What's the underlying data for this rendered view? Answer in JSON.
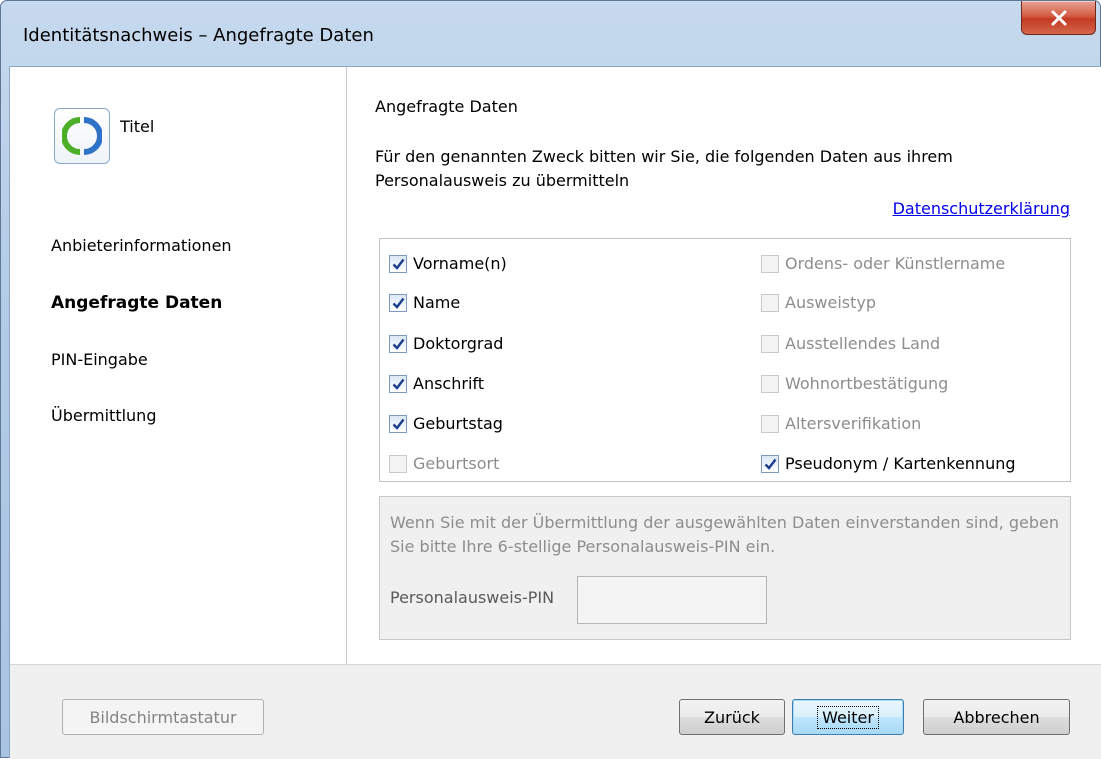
{
  "window": {
    "title": "Identitätsnachweis – Angefragte Daten"
  },
  "sidebar": {
    "provider_name": "Titel",
    "nav": [
      {
        "label": "Anbieterinformationen",
        "active": false
      },
      {
        "label": "Angefragte Daten",
        "active": true
      },
      {
        "label": "PIN-Eingabe",
        "active": false
      },
      {
        "label": "Übermittlung",
        "active": false
      }
    ]
  },
  "main": {
    "section_title": "Angefragte Daten",
    "intro": "Für den genannten Zweck bitten wir Sie, die folgenden Daten aus ihrem Personalausweis zu übermitteln",
    "privacy_link": "Datenschutzerklärung",
    "fields_left": [
      {
        "label": "Vorname(n)",
        "checked": true,
        "enabled": true
      },
      {
        "label": "Name",
        "checked": true,
        "enabled": true
      },
      {
        "label": "Doktorgrad",
        "checked": true,
        "enabled": true
      },
      {
        "label": "Anschrift",
        "checked": true,
        "enabled": true
      },
      {
        "label": "Geburtstag",
        "checked": true,
        "enabled": true
      },
      {
        "label": "Geburtsort",
        "checked": false,
        "enabled": false
      }
    ],
    "fields_right": [
      {
        "label": "Ordens- oder Künstlername",
        "checked": false,
        "enabled": false
      },
      {
        "label": "Ausweistyp",
        "checked": false,
        "enabled": false
      },
      {
        "label": "Ausstellendes Land",
        "checked": false,
        "enabled": false
      },
      {
        "label": "Wohnortbestätigung",
        "checked": false,
        "enabled": false
      },
      {
        "label": "Altersverifikation",
        "checked": false,
        "enabled": false
      },
      {
        "label": "Pseudonym / Kartenkennung",
        "checked": true,
        "enabled": true
      }
    ],
    "pin": {
      "info": "Wenn Sie mit der Übermittlung der ausgewählten Daten einverstanden sind, geben Sie bitte Ihre 6-stellige Personalausweis-PIN ein.",
      "label": "Personalausweis-PIN",
      "value": ""
    }
  },
  "footer": {
    "keyboard_button": "Bildschirmtastatur",
    "back_button": "Zurück",
    "next_button": "Weiter",
    "cancel_button": "Abbrechen"
  },
  "colors": {
    "link": "#0000ee",
    "disabled_text": "#8d8d8d",
    "close_button": "#c23b22"
  }
}
